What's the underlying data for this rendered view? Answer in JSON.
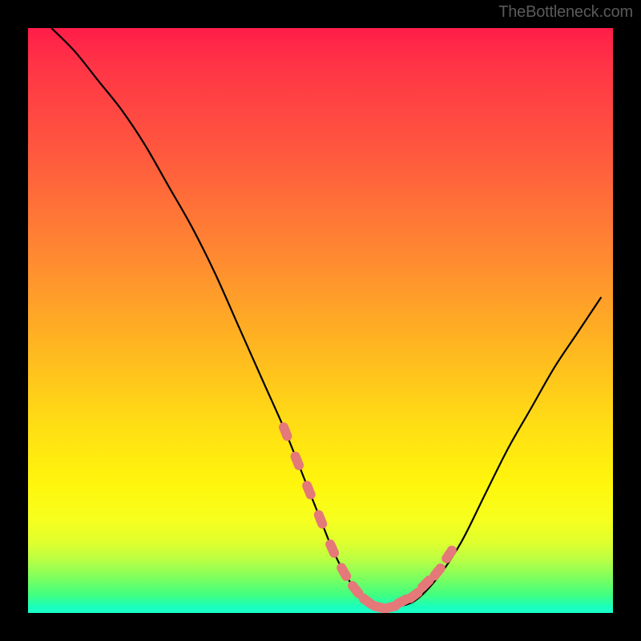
{
  "watermark": "TheBottleneck.com",
  "colors": {
    "background": "#000000",
    "curve": "#000000",
    "marker": "#e57878",
    "gradient_top": "#ff1d49",
    "gradient_bottom": "#19ffcc"
  },
  "chart_data": {
    "type": "line",
    "title": "",
    "xlabel": "",
    "ylabel": "",
    "xlim": [
      0,
      100
    ],
    "ylim": [
      0,
      100
    ],
    "series": [
      {
        "name": "bottleneck-curve",
        "x": [
          4,
          8,
          12,
          16,
          20,
          24,
          28,
          32,
          36,
          40,
          44,
          48,
          50,
          52,
          54,
          56,
          58,
          60,
          62,
          66,
          70,
          74,
          78,
          82,
          86,
          90,
          94,
          98
        ],
        "y": [
          100,
          96,
          91,
          86,
          80,
          73,
          66,
          58,
          49,
          40,
          31,
          21,
          16,
          11,
          7,
          4,
          2,
          1,
          1,
          2,
          6,
          12,
          20,
          28,
          35,
          42,
          48,
          54
        ]
      }
    ],
    "markers": {
      "name": "highlight-band",
      "x": [
        44,
        46,
        48,
        50,
        52,
        54,
        56,
        58,
        60,
        62,
        64,
        66,
        68,
        70,
        72
      ],
      "y": [
        31,
        26,
        21,
        16,
        11,
        7,
        4,
        2,
        1,
        1,
        2,
        3,
        5,
        7,
        10
      ]
    }
  }
}
